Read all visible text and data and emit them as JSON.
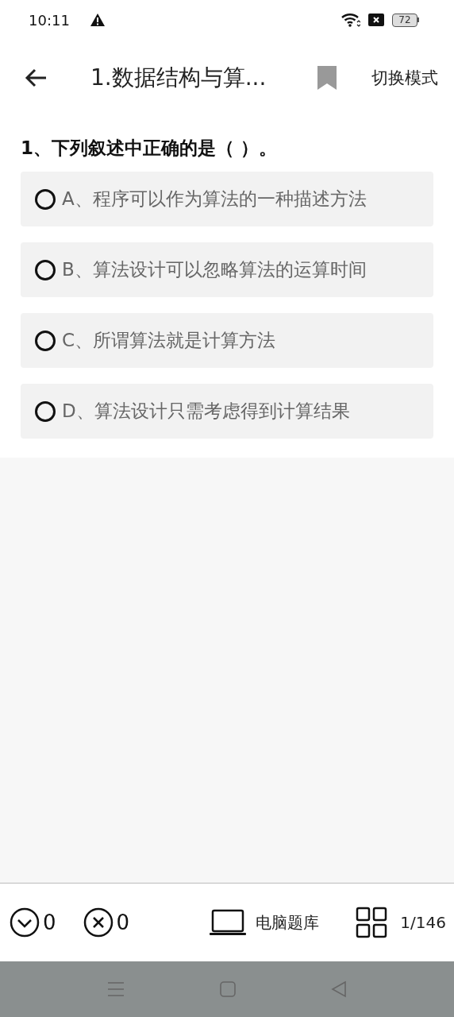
{
  "status_bar": {
    "time": "10:11",
    "battery": "72"
  },
  "header": {
    "title": "1.数据结构与算...",
    "bookmarked": false,
    "mode_button": "切换模式"
  },
  "question": {
    "text": "1、下列叙述中正确的是（ ）。",
    "options": [
      {
        "label": "A、程序可以作为算法的一种描述方法",
        "selected": false
      },
      {
        "label": "B、算法设计可以忽略算法的运算时间",
        "selected": false
      },
      {
        "label": "C、所谓算法就是计算方法",
        "selected": false
      },
      {
        "label": "D、算法设计只需考虑得到计算结果",
        "selected": false
      }
    ]
  },
  "bottom_bar": {
    "correct_count": "0",
    "wrong_count": "0",
    "bank_label": "电脑题库",
    "progress": "1/146"
  }
}
